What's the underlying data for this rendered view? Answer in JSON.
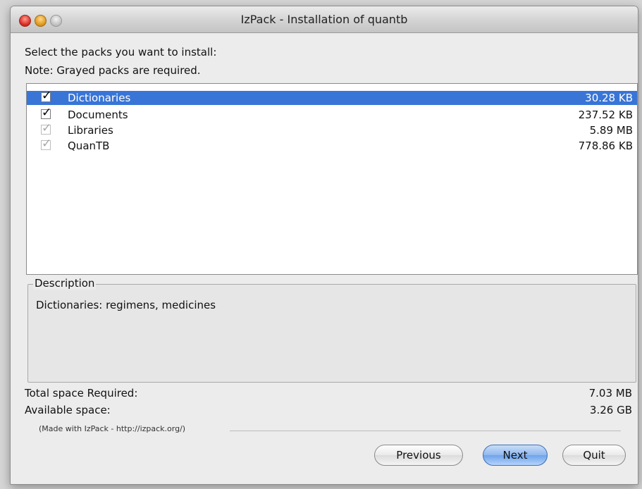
{
  "window": {
    "title": "IzPack - Installation of quantb"
  },
  "intro": {
    "line1": "Select the packs you want to install:",
    "line2": "Note: Grayed packs are required."
  },
  "packs": [
    {
      "name": "Dictionaries",
      "size": "30.28 KB",
      "checked": true,
      "required": false,
      "selected": true
    },
    {
      "name": "Documents",
      "size": "237.52 KB",
      "checked": true,
      "required": false,
      "selected": false
    },
    {
      "name": "Libraries",
      "size": "5.89 MB",
      "checked": true,
      "required": true,
      "selected": false
    },
    {
      "name": "QuanTB",
      "size": "778.86 KB",
      "checked": true,
      "required": true,
      "selected": false
    }
  ],
  "description": {
    "title": "Description",
    "text": "Dictionaries: regimens, medicines"
  },
  "space": {
    "required_label": "Total space Required:",
    "required_value": "7.03 MB",
    "available_label": "Available space:",
    "available_value": "3.26 GB"
  },
  "footer": {
    "made_with": "(Made with IzPack - http://izpack.org/)"
  },
  "buttons": {
    "previous": "Previous",
    "next": "Next",
    "quit": "Quit"
  },
  "colors": {
    "selection": "#3875d7"
  }
}
